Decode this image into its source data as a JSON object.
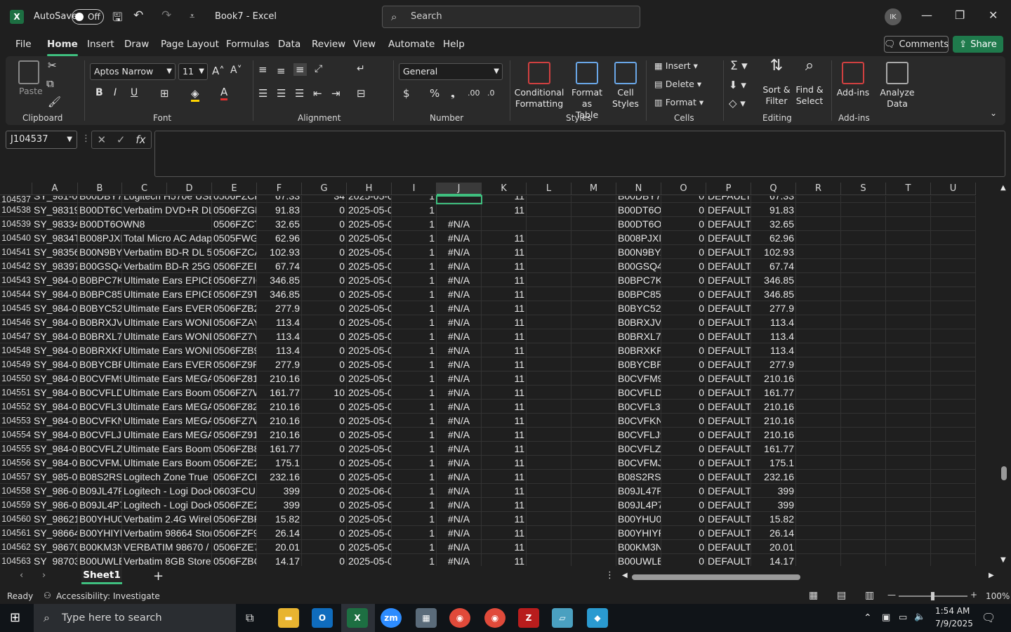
{
  "titlebar": {
    "autosave_label": "AutoSave",
    "autosave_state": "Off",
    "document_title": "Book7 - Excel",
    "search_placeholder": "Search",
    "user_initials": "IK"
  },
  "menu": [
    "File",
    "Home",
    "Insert",
    "Draw",
    "Page Layout",
    "Formulas",
    "Data",
    "Review",
    "View",
    "Automate",
    "Help"
  ],
  "active_menu": "Home",
  "comments_label": "Comments",
  "share_label": "Share",
  "ribbon": {
    "groups": [
      "Clipboard",
      "Font",
      "Alignment",
      "Number",
      "Styles",
      "Cells",
      "Editing",
      "Add-ins"
    ],
    "paste_label": "Paste",
    "font_name": "Aptos Narrow",
    "font_size": "11",
    "number_format": "General",
    "conditional_formatting": [
      "Conditional",
      "Formatting"
    ],
    "format_as_table": [
      "Format as",
      "Table"
    ],
    "cell_styles": [
      "Cell",
      "Styles"
    ],
    "insert_label": "Insert",
    "delete_label": "Delete",
    "format_label": "Format",
    "sort_filter": [
      "Sort &",
      "Filter"
    ],
    "find_select": [
      "Find &",
      "Select"
    ],
    "addins_label": "Add-ins",
    "analyze_data": [
      "Analyze",
      "Data"
    ]
  },
  "name_box": "J104537",
  "columns": [
    "A",
    "B",
    "C",
    "D",
    "E",
    "F",
    "G",
    "H",
    "I",
    "J",
    "K",
    "L",
    "M",
    "N",
    "O",
    "P",
    "Q",
    "R",
    "S",
    "T",
    "U"
  ],
  "selected_column": "J",
  "partial_row": {
    "num": "104537",
    "cells": [
      "SY_981-00",
      "B00DBY7RK",
      "Logitech H570e USB",
      "",
      "0506FZCH",
      "67.33",
      "34",
      "2025-05-06",
      "1",
      "",
      "11",
      "",
      "",
      "B00DBY7RK",
      "0",
      "DEFAULT",
      "67.33"
    ]
  },
  "rows": [
    {
      "num": "104538",
      "cells": [
        "SY_98319",
        "B00DT6OV",
        "Verbatim DVD+R DL 8",
        "",
        "0506FZGFI",
        "91.83",
        "0",
        "2025-05-06",
        "1",
        "",
        "11",
        "",
        "",
        "B00DT6OV",
        "0",
        "DEFAULT",
        "91.83"
      ]
    },
    {
      "num": "104539",
      "cells": [
        "SY_98334",
        "B00DT6OWN8",
        "",
        "",
        "0506FZCTC",
        "32.65",
        "0",
        "2025-05-06",
        "1",
        "#N/A",
        "",
        "",
        "",
        "B00DT6OV",
        "0",
        "DEFAULT",
        "32.65"
      ]
    },
    {
      "num": "104540",
      "cells": [
        "SY_9834T-",
        "B008PJXM",
        "Total Micro AC Adapt",
        "",
        "0505FWGV",
        "62.96",
        "0",
        "2025-05-05",
        "1",
        "#N/A",
        "11",
        "",
        "",
        "B008PJXM",
        "0",
        "DEFAULT",
        "62.96"
      ]
    },
    {
      "num": "104541",
      "cells": [
        "SY_98356",
        "B00N9BYA",
        "Verbatim BD-R DL 50",
        "",
        "0506FZCAI",
        "102.93",
        "0",
        "2025-05-06",
        "1",
        "#N/A",
        "11",
        "",
        "",
        "B00N9BYA",
        "0",
        "DEFAULT",
        "102.93"
      ]
    },
    {
      "num": "104542",
      "cells": [
        "SY_98397",
        "B00GSQ4D",
        "Verbatim BD-R 25GB",
        "",
        "0506FZEI2",
        "67.74",
        "0",
        "2025-05-06",
        "1",
        "#N/A",
        "11",
        "",
        "",
        "B00GSQ4D",
        "0",
        "DEFAULT",
        "67.74"
      ]
    },
    {
      "num": "104543",
      "cells": [
        "SY_984-00",
        "B0BPC7K8",
        "Ultimate Ears EPICBO",
        "",
        "0506FZ7IG",
        "346.85",
        "0",
        "2025-05-06",
        "1",
        "#N/A",
        "11",
        "",
        "",
        "B0BPC7K8",
        "0",
        "DEFAULT",
        "346.85"
      ]
    },
    {
      "num": "104544",
      "cells": [
        "SY_984-00",
        "B0BPC855",
        "Ultimate Ears EPICBO",
        "",
        "0506FZ9TC",
        "346.85",
        "0",
        "2025-05-06",
        "1",
        "#N/A",
        "11",
        "",
        "",
        "B0BPC855",
        "0",
        "DEFAULT",
        "346.85"
      ]
    },
    {
      "num": "104545",
      "cells": [
        "SY_984-00",
        "B0BYC52L",
        "Ultimate Ears EVERBO",
        "",
        "0506FZB2Y",
        "277.9",
        "0",
        "2025-05-06",
        "1",
        "#N/A",
        "11",
        "",
        "",
        "B0BYC52L",
        "0",
        "DEFAULT",
        "277.9"
      ]
    },
    {
      "num": "104546",
      "cells": [
        "SY_984-00",
        "B0BRXJVG",
        "Ultimate Ears WOND",
        "",
        "0506FZAYN",
        "113.4",
        "0",
        "2025-05-06",
        "1",
        "#N/A",
        "11",
        "",
        "",
        "B0BRXJVG",
        "0",
        "DEFAULT",
        "113.4"
      ]
    },
    {
      "num": "104547",
      "cells": [
        "SY_984-00",
        "B0BRXL78",
        "Ultimate Ears WOND",
        "",
        "0506FZ7YU",
        "113.4",
        "0",
        "2025-05-06",
        "1",
        "#N/A",
        "11",
        "",
        "",
        "B0BRXL78I",
        "0",
        "DEFAULT",
        "113.4"
      ]
    },
    {
      "num": "104548",
      "cells": [
        "SY_984-00",
        "B0BRXKFD",
        "Ultimate Ears WOND",
        "",
        "0506FZB9X",
        "113.4",
        "0",
        "2025-05-06",
        "1",
        "#N/A",
        "11",
        "",
        "",
        "B0BRXKFD",
        "0",
        "DEFAULT",
        "113.4"
      ]
    },
    {
      "num": "104549",
      "cells": [
        "SY_984-00",
        "B0BYCBRX",
        "Ultimate Ears EVERBO",
        "",
        "0506FZ9PF",
        "277.9",
        "0",
        "2025-05-06",
        "1",
        "#N/A",
        "11",
        "",
        "",
        "B0BYCBRX",
        "0",
        "DEFAULT",
        "277.9"
      ]
    },
    {
      "num": "104550",
      "cells": [
        "SY_984-00",
        "B0CVFM97",
        "Ultimate Ears MEGAB",
        "",
        "0506FZ81N",
        "210.16",
        "0",
        "2025-05-06",
        "1",
        "#N/A",
        "11",
        "",
        "",
        "B0CVFM97",
        "0",
        "DEFAULT",
        "210.16"
      ]
    },
    {
      "num": "104551",
      "cells": [
        "SY_984-00",
        "B0CVFLDX",
        "Ultimate Ears Boom",
        "",
        "0506FZ7W",
        "161.77",
        "10",
        "2025-05-06",
        "1",
        "#N/A",
        "11",
        "",
        "",
        "B0CVFLDX",
        "0",
        "DEFAULT",
        "161.77"
      ]
    },
    {
      "num": "104552",
      "cells": [
        "SY_984-00",
        "B0CVFL3K",
        "Ultimate Ears MEGAB",
        "",
        "0506FZ823",
        "210.16",
        "0",
        "2025-05-06",
        "1",
        "#N/A",
        "11",
        "",
        "",
        "B0CVFL3K",
        "0",
        "DEFAULT",
        "210.16"
      ]
    },
    {
      "num": "104553",
      "cells": [
        "SY_984-00",
        "B0CVFKNY",
        "Ultimate Ears MEGAB",
        "",
        "0506FZ7W",
        "210.16",
        "0",
        "2025-05-06",
        "1",
        "#N/A",
        "11",
        "",
        "",
        "B0CVFKNY",
        "0",
        "DEFAULT",
        "210.16"
      ]
    },
    {
      "num": "104554",
      "cells": [
        "SY_984-00",
        "B0CVFLJ9F",
        "Ultimate Ears MEGAB",
        "",
        "0506FZ91F",
        "210.16",
        "0",
        "2025-05-06",
        "1",
        "#N/A",
        "11",
        "",
        "",
        "B0CVFLJ9F",
        "0",
        "DEFAULT",
        "210.16"
      ]
    },
    {
      "num": "104555",
      "cells": [
        "SY_984-00",
        "B0CVFLZS",
        "Ultimate Ears Boom",
        "",
        "0506FZB8X",
        "161.77",
        "0",
        "2025-05-06",
        "1",
        "#N/A",
        "11",
        "",
        "",
        "B0CVFLZS",
        "0",
        "DEFAULT",
        "161.77"
      ]
    },
    {
      "num": "104556",
      "cells": [
        "SY_984-00",
        "B0CVFMJ7",
        "Ultimate Ears Boom",
        "",
        "0506FZE2S",
        "175.1",
        "0",
        "2025-05-06",
        "1",
        "#N/A",
        "11",
        "",
        "",
        "B0CVFMJ7",
        "0",
        "DEFAULT",
        "175.1"
      ]
    },
    {
      "num": "104557",
      "cells": [
        "SY_985-00",
        "B08S2RSZ",
        "Logitech Zone True W",
        "",
        "0506FZCHI",
        "232.16",
        "0",
        "2025-05-06",
        "1",
        "#N/A",
        "11",
        "",
        "",
        "B08S2RSZ",
        "0",
        "DEFAULT",
        "232.16"
      ]
    },
    {
      "num": "104558",
      "cells": [
        "SY_986-00",
        "B09JL47R1",
        "Logitech - Logi Dock,",
        "",
        "0603FCUB",
        "399",
        "0",
        "2025-06-03",
        "1",
        "#N/A",
        "11",
        "",
        "",
        "B09JL47R1",
        "0",
        "DEFAULT",
        "399"
      ]
    },
    {
      "num": "104559",
      "cells": [
        "SY_986-00",
        "B09JL4P7Y",
        "Logitech - Logi Dock,",
        "",
        "0506FZE28",
        "399",
        "0",
        "2025-05-06",
        "1",
        "#N/A",
        "11",
        "",
        "",
        "B09JL4P7Y",
        "0",
        "DEFAULT",
        "399"
      ]
    },
    {
      "num": "104560",
      "cells": [
        "SY_98621",
        "B00YHU0K",
        "Verbatim 2.4G Wirele",
        "",
        "0506FZBP",
        "15.82",
        "0",
        "2025-05-06",
        "1",
        "#N/A",
        "11",
        "",
        "",
        "B00YHU0K",
        "0",
        "DEFAULT",
        "15.82"
      ]
    },
    {
      "num": "104561",
      "cells": [
        "SY_98664",
        "B00YHIYRL",
        "Verbatim 98664 Store",
        "",
        "0506FZF9C",
        "26.14",
        "0",
        "2025-05-06",
        "1",
        "#N/A",
        "11",
        "",
        "",
        "B00YHIYRL",
        "0",
        "DEFAULT",
        "26.14"
      ]
    },
    {
      "num": "104562",
      "cells": [
        "SY_98670",
        "B00KM3NY",
        "VERBATIM 98670 / 64",
        "",
        "0506FZE7U",
        "20.01",
        "0",
        "2025-05-06",
        "1",
        "#N/A",
        "11",
        "",
        "",
        "B00KM3NY",
        "0",
        "DEFAULT",
        "20.01"
      ]
    },
    {
      "num": "104563",
      "cells": [
        "SY_98703",
        "B00UWLEH",
        "Verbatim 8GB Store 'n",
        "",
        "0506FZBG",
        "14.17",
        "0",
        "2025-05-06",
        "1",
        "#N/A",
        "11",
        "",
        "",
        "B00UWLEH",
        "0",
        "DEFAULT",
        "14.17"
      ]
    }
  ],
  "sheet_tab": "Sheet1",
  "status": {
    "ready": "Ready",
    "accessibility": "Accessibility: Investigate",
    "zoom": "100%"
  },
  "taskbar": {
    "search_placeholder": "Type here to search",
    "time": "1:54 AM",
    "date": "7/9/2025"
  }
}
